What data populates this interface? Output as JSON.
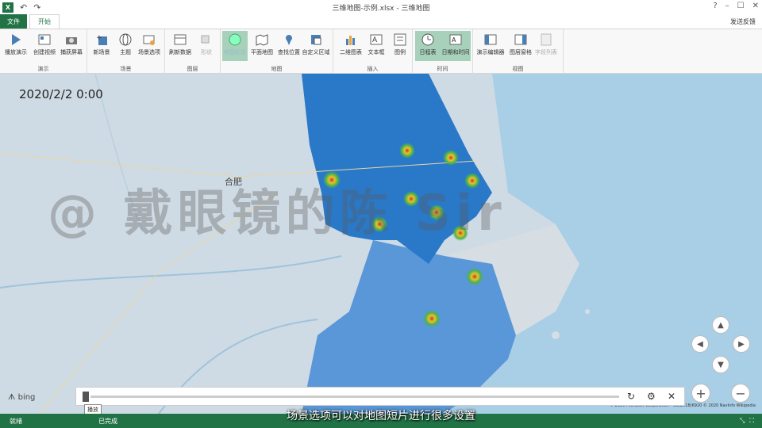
{
  "titlebar": {
    "app_icon": "X",
    "title": "三维地图-示例.xlsx - 三维地图",
    "buttons": [
      "?",
      "–",
      "☐",
      "✕"
    ]
  },
  "tabs": {
    "file": "文件",
    "home": "开始",
    "feedback": "发送反馈"
  },
  "ribbon": {
    "groups": [
      {
        "label": "演示",
        "buttons": [
          "播放演示",
          "创建视频",
          "捕获屏幕"
        ]
      },
      {
        "label": "场景",
        "buttons": [
          "新场景",
          "主题",
          "场景选项"
        ]
      },
      {
        "label": "图层",
        "buttons": [
          "刷新数据",
          "形状"
        ]
      },
      {
        "label": "地图",
        "buttons": [
          "平面地图",
          "查找位置",
          "自定义区域"
        ]
      },
      {
        "label": "插入",
        "buttons": [
          "二维图表",
          "文本框",
          "图例"
        ]
      },
      {
        "label": "时间",
        "buttons": [
          "日程表",
          "日期和时间"
        ]
      },
      {
        "label": "视图",
        "buttons": [
          "演示编辑器",
          "图层窗格",
          "字段列表"
        ]
      }
    ],
    "map_labels_button": "地图标签"
  },
  "map": {
    "timestamp": "2020/2/2 0:00",
    "watermark": "@ 戴眼镜的陈 Sir",
    "city_label": "合肥",
    "brand": "bing",
    "credits": "© 2020 Microsoft Corporation - GS(2018)6920 © 2020 NavInfo Wikipedia",
    "tooltip": "播放",
    "colors": {
      "province_dark": "#2a78c8",
      "province_light": "#4b8fd6",
      "sea": "#a9cfe6",
      "land": "#cfdbe4"
    }
  },
  "status": {
    "ready": "就绪",
    "done": "已完成"
  },
  "subtitle": "场景选项可以对地图短片进行很多设置"
}
